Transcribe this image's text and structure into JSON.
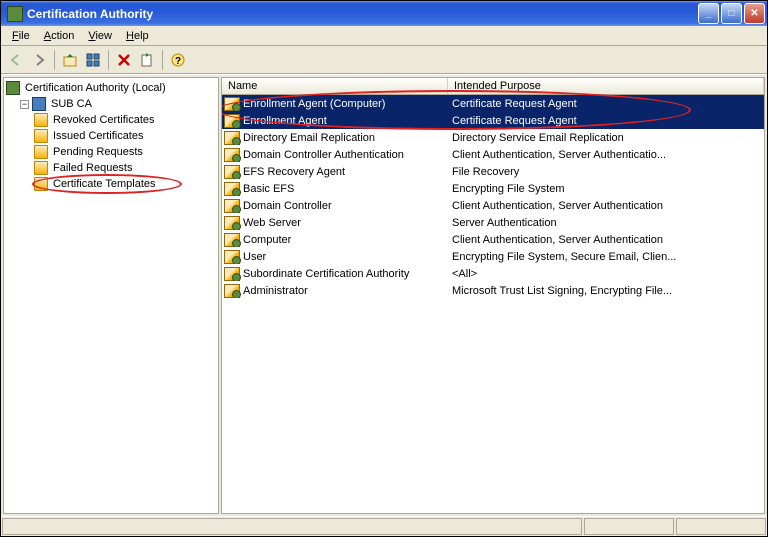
{
  "window": {
    "title": "Certification Authority"
  },
  "menu": {
    "file": "File",
    "action": "Action",
    "view": "View",
    "help": "Help"
  },
  "tree": {
    "root": "Certification Authority (Local)",
    "sub": "SUB CA",
    "children": [
      {
        "label": "Revoked Certificates"
      },
      {
        "label": "Issued Certificates"
      },
      {
        "label": "Pending Requests"
      },
      {
        "label": "Failed Requests"
      },
      {
        "label": "Certificate Templates"
      }
    ]
  },
  "columns": {
    "name": "Name",
    "purpose": "Intended Purpose"
  },
  "rows": [
    {
      "name": "Enrollment Agent (Computer)",
      "purpose": "Certificate Request Agent",
      "selected": true
    },
    {
      "name": "Enrollment Agent",
      "purpose": "Certificate Request Agent",
      "selected": true
    },
    {
      "name": "Directory Email Replication",
      "purpose": "Directory Service Email Replication"
    },
    {
      "name": "Domain Controller Authentication",
      "purpose": "Client Authentication, Server Authenticatio..."
    },
    {
      "name": "EFS Recovery Agent",
      "purpose": "File Recovery"
    },
    {
      "name": "Basic EFS",
      "purpose": "Encrypting File System"
    },
    {
      "name": "Domain Controller",
      "purpose": "Client Authentication, Server Authentication"
    },
    {
      "name": "Web Server",
      "purpose": "Server Authentication"
    },
    {
      "name": "Computer",
      "purpose": "Client Authentication, Server Authentication"
    },
    {
      "name": "User",
      "purpose": "Encrypting File System, Secure Email, Clien..."
    },
    {
      "name": "Subordinate Certification Authority",
      "purpose": "<All>"
    },
    {
      "name": "Administrator",
      "purpose": "Microsoft Trust List Signing, Encrypting File..."
    }
  ]
}
